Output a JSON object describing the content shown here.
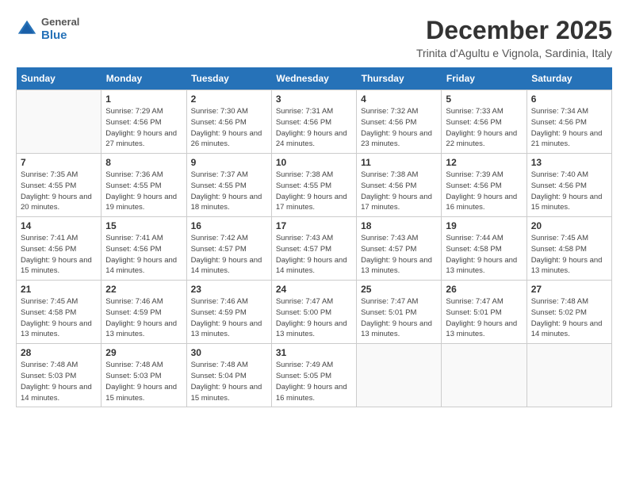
{
  "header": {
    "logo_general": "General",
    "logo_blue": "Blue",
    "month": "December 2025",
    "location": "Trinita d'Agultu e Vignola, Sardinia, Italy"
  },
  "days_of_week": [
    "Sunday",
    "Monday",
    "Tuesday",
    "Wednesday",
    "Thursday",
    "Friday",
    "Saturday"
  ],
  "weeks": [
    [
      {
        "day": "",
        "sunrise": "",
        "sunset": "",
        "daylight": ""
      },
      {
        "day": "1",
        "sunrise": "Sunrise: 7:29 AM",
        "sunset": "Sunset: 4:56 PM",
        "daylight": "Daylight: 9 hours and 27 minutes."
      },
      {
        "day": "2",
        "sunrise": "Sunrise: 7:30 AM",
        "sunset": "Sunset: 4:56 PM",
        "daylight": "Daylight: 9 hours and 26 minutes."
      },
      {
        "day": "3",
        "sunrise": "Sunrise: 7:31 AM",
        "sunset": "Sunset: 4:56 PM",
        "daylight": "Daylight: 9 hours and 24 minutes."
      },
      {
        "day": "4",
        "sunrise": "Sunrise: 7:32 AM",
        "sunset": "Sunset: 4:56 PM",
        "daylight": "Daylight: 9 hours and 23 minutes."
      },
      {
        "day": "5",
        "sunrise": "Sunrise: 7:33 AM",
        "sunset": "Sunset: 4:56 PM",
        "daylight": "Daylight: 9 hours and 22 minutes."
      },
      {
        "day": "6",
        "sunrise": "Sunrise: 7:34 AM",
        "sunset": "Sunset: 4:56 PM",
        "daylight": "Daylight: 9 hours and 21 minutes."
      }
    ],
    [
      {
        "day": "7",
        "sunrise": "Sunrise: 7:35 AM",
        "sunset": "Sunset: 4:55 PM",
        "daylight": "Daylight: 9 hours and 20 minutes."
      },
      {
        "day": "8",
        "sunrise": "Sunrise: 7:36 AM",
        "sunset": "Sunset: 4:55 PM",
        "daylight": "Daylight: 9 hours and 19 minutes."
      },
      {
        "day": "9",
        "sunrise": "Sunrise: 7:37 AM",
        "sunset": "Sunset: 4:55 PM",
        "daylight": "Daylight: 9 hours and 18 minutes."
      },
      {
        "day": "10",
        "sunrise": "Sunrise: 7:38 AM",
        "sunset": "Sunset: 4:55 PM",
        "daylight": "Daylight: 9 hours and 17 minutes."
      },
      {
        "day": "11",
        "sunrise": "Sunrise: 7:38 AM",
        "sunset": "Sunset: 4:56 PM",
        "daylight": "Daylight: 9 hours and 17 minutes."
      },
      {
        "day": "12",
        "sunrise": "Sunrise: 7:39 AM",
        "sunset": "Sunset: 4:56 PM",
        "daylight": "Daylight: 9 hours and 16 minutes."
      },
      {
        "day": "13",
        "sunrise": "Sunrise: 7:40 AM",
        "sunset": "Sunset: 4:56 PM",
        "daylight": "Daylight: 9 hours and 15 minutes."
      }
    ],
    [
      {
        "day": "14",
        "sunrise": "Sunrise: 7:41 AM",
        "sunset": "Sunset: 4:56 PM",
        "daylight": "Daylight: 9 hours and 15 minutes."
      },
      {
        "day": "15",
        "sunrise": "Sunrise: 7:41 AM",
        "sunset": "Sunset: 4:56 PM",
        "daylight": "Daylight: 9 hours and 14 minutes."
      },
      {
        "day": "16",
        "sunrise": "Sunrise: 7:42 AM",
        "sunset": "Sunset: 4:57 PM",
        "daylight": "Daylight: 9 hours and 14 minutes."
      },
      {
        "day": "17",
        "sunrise": "Sunrise: 7:43 AM",
        "sunset": "Sunset: 4:57 PM",
        "daylight": "Daylight: 9 hours and 14 minutes."
      },
      {
        "day": "18",
        "sunrise": "Sunrise: 7:43 AM",
        "sunset": "Sunset: 4:57 PM",
        "daylight": "Daylight: 9 hours and 13 minutes."
      },
      {
        "day": "19",
        "sunrise": "Sunrise: 7:44 AM",
        "sunset": "Sunset: 4:58 PM",
        "daylight": "Daylight: 9 hours and 13 minutes."
      },
      {
        "day": "20",
        "sunrise": "Sunrise: 7:45 AM",
        "sunset": "Sunset: 4:58 PM",
        "daylight": "Daylight: 9 hours and 13 minutes."
      }
    ],
    [
      {
        "day": "21",
        "sunrise": "Sunrise: 7:45 AM",
        "sunset": "Sunset: 4:58 PM",
        "daylight": "Daylight: 9 hours and 13 minutes."
      },
      {
        "day": "22",
        "sunrise": "Sunrise: 7:46 AM",
        "sunset": "Sunset: 4:59 PM",
        "daylight": "Daylight: 9 hours and 13 minutes."
      },
      {
        "day": "23",
        "sunrise": "Sunrise: 7:46 AM",
        "sunset": "Sunset: 4:59 PM",
        "daylight": "Daylight: 9 hours and 13 minutes."
      },
      {
        "day": "24",
        "sunrise": "Sunrise: 7:47 AM",
        "sunset": "Sunset: 5:00 PM",
        "daylight": "Daylight: 9 hours and 13 minutes."
      },
      {
        "day": "25",
        "sunrise": "Sunrise: 7:47 AM",
        "sunset": "Sunset: 5:01 PM",
        "daylight": "Daylight: 9 hours and 13 minutes."
      },
      {
        "day": "26",
        "sunrise": "Sunrise: 7:47 AM",
        "sunset": "Sunset: 5:01 PM",
        "daylight": "Daylight: 9 hours and 13 minutes."
      },
      {
        "day": "27",
        "sunrise": "Sunrise: 7:48 AM",
        "sunset": "Sunset: 5:02 PM",
        "daylight": "Daylight: 9 hours and 14 minutes."
      }
    ],
    [
      {
        "day": "28",
        "sunrise": "Sunrise: 7:48 AM",
        "sunset": "Sunset: 5:03 PM",
        "daylight": "Daylight: 9 hours and 14 minutes."
      },
      {
        "day": "29",
        "sunrise": "Sunrise: 7:48 AM",
        "sunset": "Sunset: 5:03 PM",
        "daylight": "Daylight: 9 hours and 15 minutes."
      },
      {
        "day": "30",
        "sunrise": "Sunrise: 7:48 AM",
        "sunset": "Sunset: 5:04 PM",
        "daylight": "Daylight: 9 hours and 15 minutes."
      },
      {
        "day": "31",
        "sunrise": "Sunrise: 7:49 AM",
        "sunset": "Sunset: 5:05 PM",
        "daylight": "Daylight: 9 hours and 16 minutes."
      },
      {
        "day": "",
        "sunrise": "",
        "sunset": "",
        "daylight": ""
      },
      {
        "day": "",
        "sunrise": "",
        "sunset": "",
        "daylight": ""
      },
      {
        "day": "",
        "sunrise": "",
        "sunset": "",
        "daylight": ""
      }
    ]
  ]
}
